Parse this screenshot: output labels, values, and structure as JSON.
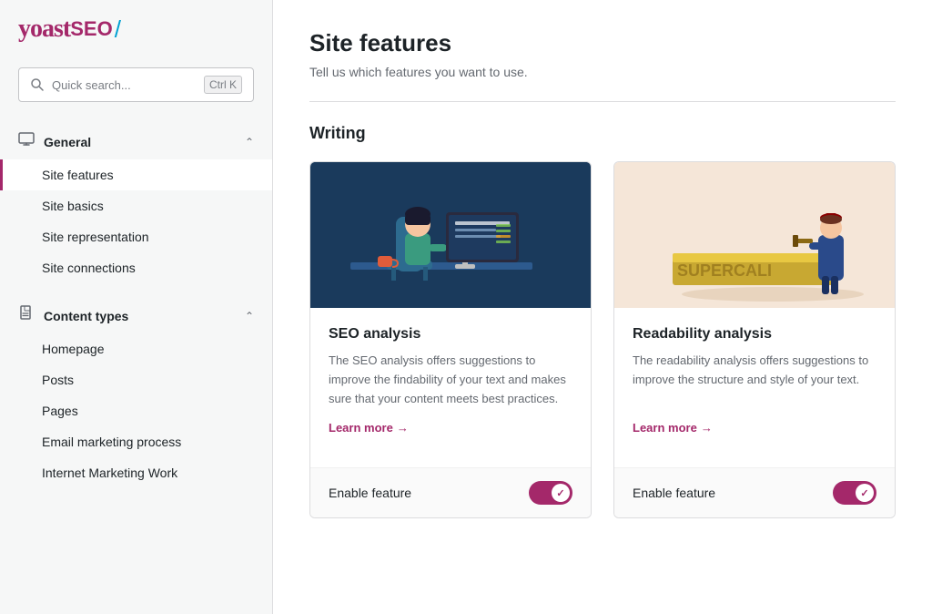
{
  "logo": {
    "yoast": "yoast",
    "seo": "SEO",
    "slash": "/"
  },
  "search": {
    "placeholder": "Quick search...",
    "shortcut": "Ctrl K"
  },
  "sidebar": {
    "sections": [
      {
        "id": "general",
        "icon": "monitor-icon",
        "icon_char": "🖥",
        "title": "General",
        "expanded": true,
        "items": [
          {
            "id": "site-features",
            "label": "Site features",
            "active": true
          },
          {
            "id": "site-basics",
            "label": "Site basics",
            "active": false
          },
          {
            "id": "site-representation",
            "label": "Site representation",
            "active": false
          },
          {
            "id": "site-connections",
            "label": "Site connections",
            "active": false
          }
        ]
      },
      {
        "id": "content-types",
        "icon": "document-icon",
        "icon_char": "📄",
        "title": "Content types",
        "expanded": true,
        "items": [
          {
            "id": "homepage",
            "label": "Homepage",
            "active": false
          },
          {
            "id": "posts",
            "label": "Posts",
            "active": false
          },
          {
            "id": "pages",
            "label": "Pages",
            "active": false
          },
          {
            "id": "email-marketing",
            "label": "Email marketing process",
            "active": false
          },
          {
            "id": "internet-marketing",
            "label": "Internet Marketing Work",
            "active": false
          }
        ]
      }
    ]
  },
  "main": {
    "title": "Site features",
    "subtitle": "Tell us which features you want to use.",
    "sections": [
      {
        "id": "writing",
        "heading": "Writing",
        "cards": [
          {
            "id": "seo-analysis",
            "image_type": "seo",
            "title": "SEO analysis",
            "description": "The SEO analysis offers suggestions to improve the findability of your text and makes sure that your content meets best practices.",
            "learn_more": "Learn more",
            "learn_more_arrow": "→",
            "enable_label": "Enable feature",
            "enabled": true
          },
          {
            "id": "readability-analysis",
            "image_type": "readability",
            "title": "Readability analysis",
            "description": "The readability analysis offers suggestions to improve the structure and style of your text.",
            "learn_more": "Learn more",
            "learn_more_arrow": "→",
            "enable_label": "Enable feature",
            "enabled": true
          }
        ]
      }
    ]
  }
}
